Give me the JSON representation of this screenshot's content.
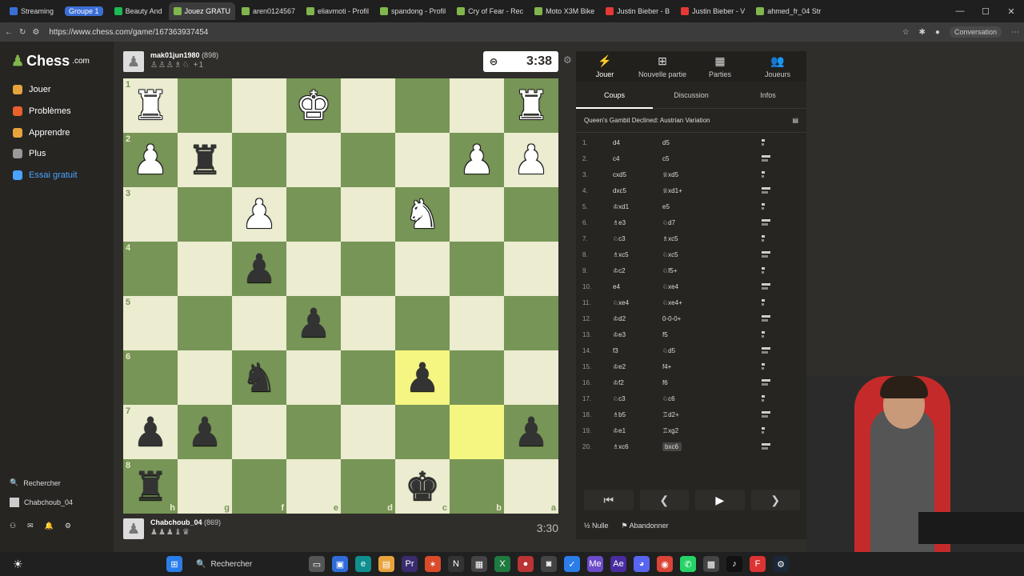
{
  "browser": {
    "tabs": [
      {
        "label": "Streaming",
        "color": "#3b6fd6"
      },
      {
        "label": "Groupe 1",
        "color": "#3b6fd6",
        "group": true
      },
      {
        "label": "Beauty And",
        "color": "#1db954"
      },
      {
        "label": "Jouez GRATU",
        "color": "#81b64c",
        "active": true
      },
      {
        "label": "aren0124567",
        "color": "#81b64c"
      },
      {
        "label": "eliavmoti - Profil",
        "color": "#81b64c"
      },
      {
        "label": "spandong - Profil",
        "color": "#81b64c"
      },
      {
        "label": "Cry of Fear - Rec",
        "color": "#81b64c"
      },
      {
        "label": "Moto X3M Bike",
        "color": "#81b64c"
      },
      {
        "label": "Justin Bieber - B",
        "color": "#e53935"
      },
      {
        "label": "Justin Bieber - V",
        "color": "#e53935"
      },
      {
        "label": "ahmed_fr_04 Str",
        "color": "#81b64c"
      }
    ],
    "url": "https://www.chess.com/game/167363937454",
    "conversation_label": "Conversation"
  },
  "sidebar": {
    "logo": "Chess",
    "logo_suffix": ".com",
    "items": [
      {
        "label": "Jouer",
        "color": "#e8a33d"
      },
      {
        "label": "Problèmes",
        "color": "#e8612c"
      },
      {
        "label": "Apprendre",
        "color": "#e8a33d"
      },
      {
        "label": "Plus",
        "color": "#999999"
      },
      {
        "label": "Essai gratuit",
        "color": "#4aa3ff"
      }
    ],
    "search_label": "Rechercher",
    "user_label": "Chabchoub_04"
  },
  "top_player": {
    "name": "mak01jun1980",
    "rating": "(898)",
    "captured": "+1"
  },
  "bottom_player": {
    "name": "Chabchoub_04",
    "rating": "(869)"
  },
  "clocks": {
    "top": "3:38",
    "bottom": "3:30"
  },
  "board": {
    "ranks": [
      "1",
      "2",
      "3",
      "4",
      "5",
      "6",
      "7",
      "8"
    ],
    "files": [
      "h",
      "g",
      "f",
      "e",
      "d",
      "c",
      "b",
      "a"
    ],
    "pieces": [
      {
        "row": 0,
        "col": 0,
        "glyph": "♜",
        "color": "w"
      },
      {
        "row": 0,
        "col": 3,
        "glyph": "♚",
        "color": "w"
      },
      {
        "row": 0,
        "col": 7,
        "glyph": "♜",
        "color": "w"
      },
      {
        "row": 1,
        "col": 0,
        "glyph": "♟",
        "color": "w"
      },
      {
        "row": 1,
        "col": 1,
        "glyph": "♜",
        "color": "b"
      },
      {
        "row": 1,
        "col": 6,
        "glyph": "♟",
        "color": "w"
      },
      {
        "row": 1,
        "col": 7,
        "glyph": "♟",
        "color": "w"
      },
      {
        "row": 2,
        "col": 2,
        "glyph": "♟",
        "color": "w"
      },
      {
        "row": 2,
        "col": 5,
        "glyph": "♞",
        "color": "w"
      },
      {
        "row": 3,
        "col": 2,
        "glyph": "♟",
        "color": "b"
      },
      {
        "row": 4,
        "col": 3,
        "glyph": "♟",
        "color": "b"
      },
      {
        "row": 5,
        "col": 2,
        "glyph": "♞",
        "color": "b"
      },
      {
        "row": 5,
        "col": 5,
        "glyph": "♟",
        "color": "b"
      },
      {
        "row": 6,
        "col": 0,
        "glyph": "♟",
        "color": "b"
      },
      {
        "row": 6,
        "col": 1,
        "glyph": "♟",
        "color": "b"
      },
      {
        "row": 6,
        "col": 7,
        "glyph": "♟",
        "color": "b"
      },
      {
        "row": 7,
        "col": 0,
        "glyph": "♜",
        "color": "b"
      },
      {
        "row": 7,
        "col": 5,
        "glyph": "♚",
        "color": "b"
      }
    ],
    "highlights": [
      {
        "row": 5,
        "col": 5
      },
      {
        "row": 6,
        "col": 6
      }
    ]
  },
  "panel": {
    "top_tabs": [
      {
        "label": "Jouer",
        "icon": "⚡"
      },
      {
        "label": "Nouvelle partie",
        "icon": "⊞"
      },
      {
        "label": "Parties",
        "icon": "▦"
      },
      {
        "label": "Joueurs",
        "icon": "👥"
      }
    ],
    "sub_tabs": [
      "Coups",
      "Discussion",
      "Infos"
    ],
    "opening": "Queen's Gambit Declined: Austrian Variation",
    "moves": [
      {
        "n": "1.",
        "w": "d4",
        "b": "d5"
      },
      {
        "n": "2.",
        "w": "c4",
        "b": "c5"
      },
      {
        "n": "3.",
        "w": "cxd5",
        "b": "♕xd5"
      },
      {
        "n": "4.",
        "w": "dxc5",
        "b": "♕xd1+"
      },
      {
        "n": "5.",
        "w": "♔xd1",
        "b": "e5"
      },
      {
        "n": "6.",
        "w": "♗e3",
        "b": "♘d7"
      },
      {
        "n": "7.",
        "w": "♘c3",
        "b": "♗xc5"
      },
      {
        "n": "8.",
        "w": "♗xc5",
        "b": "♘xc5"
      },
      {
        "n": "9.",
        "w": "♔c2",
        "b": "♘f5+"
      },
      {
        "n": "10.",
        "w": "e4",
        "b": "♘xe4"
      },
      {
        "n": "11.",
        "w": "♘xe4",
        "b": "♘xe4+"
      },
      {
        "n": "12.",
        "w": "♔d2",
        "b": "0-0-0+"
      },
      {
        "n": "13.",
        "w": "♔e3",
        "b": "f5"
      },
      {
        "n": "14.",
        "w": "f3",
        "b": "♘d5"
      },
      {
        "n": "15.",
        "w": "♔e2",
        "b": "f4+"
      },
      {
        "n": "16.",
        "w": "♔f2",
        "b": "f6"
      },
      {
        "n": "17.",
        "w": "♘c3",
        "b": "♘c6"
      },
      {
        "n": "18.",
        "w": "♗b5",
        "b": "♖d2+"
      },
      {
        "n": "19.",
        "w": "♔e1",
        "b": "♖xg2"
      },
      {
        "n": "20.",
        "w": "♗xc6",
        "b": "bxc6"
      }
    ],
    "draw_label": "Nulle",
    "resign_label": "Abandonner"
  },
  "taskbar": {
    "search_label": "Rechercher"
  }
}
